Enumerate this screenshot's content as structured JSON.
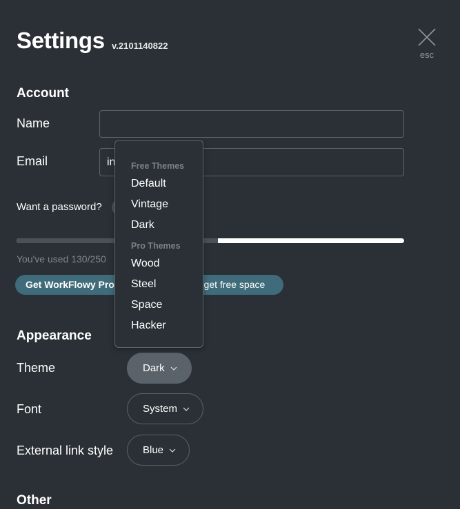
{
  "header": {
    "title": "Settings",
    "version": "v.2101140822",
    "close_label": "esc"
  },
  "account": {
    "heading": "Account",
    "name_label": "Name",
    "name_value": "",
    "email_label": "Email",
    "email_value": "in",
    "password_label": "Want a password?",
    "usage_text": "You've used 130/250",
    "usage_fraction": 0.52,
    "pro_button_label": "Get WorkFlowy Pro",
    "free_space_label": "– get free space"
  },
  "theme_menu": {
    "free_group": "Free Themes",
    "free_items": [
      "Default",
      "Vintage",
      "Dark"
    ],
    "pro_group": "Pro Themes",
    "pro_items": [
      "Wood",
      "Steel",
      "Space",
      "Hacker"
    ]
  },
  "appearance": {
    "heading": "Appearance",
    "theme_label": "Theme",
    "theme_value": "Dark",
    "font_label": "Font",
    "font_value": "System",
    "link_label": "External link style",
    "link_value": "Blue"
  },
  "other": {
    "heading": "Other"
  },
  "colors": {
    "background": "#2a3035",
    "accent_button": "#3f6b7a",
    "selected_pill": "#5b636a",
    "muted_text": "#7f878d"
  },
  "icons": {
    "close": "close-x-icon",
    "dropdown": "chevron-down-icon"
  }
}
